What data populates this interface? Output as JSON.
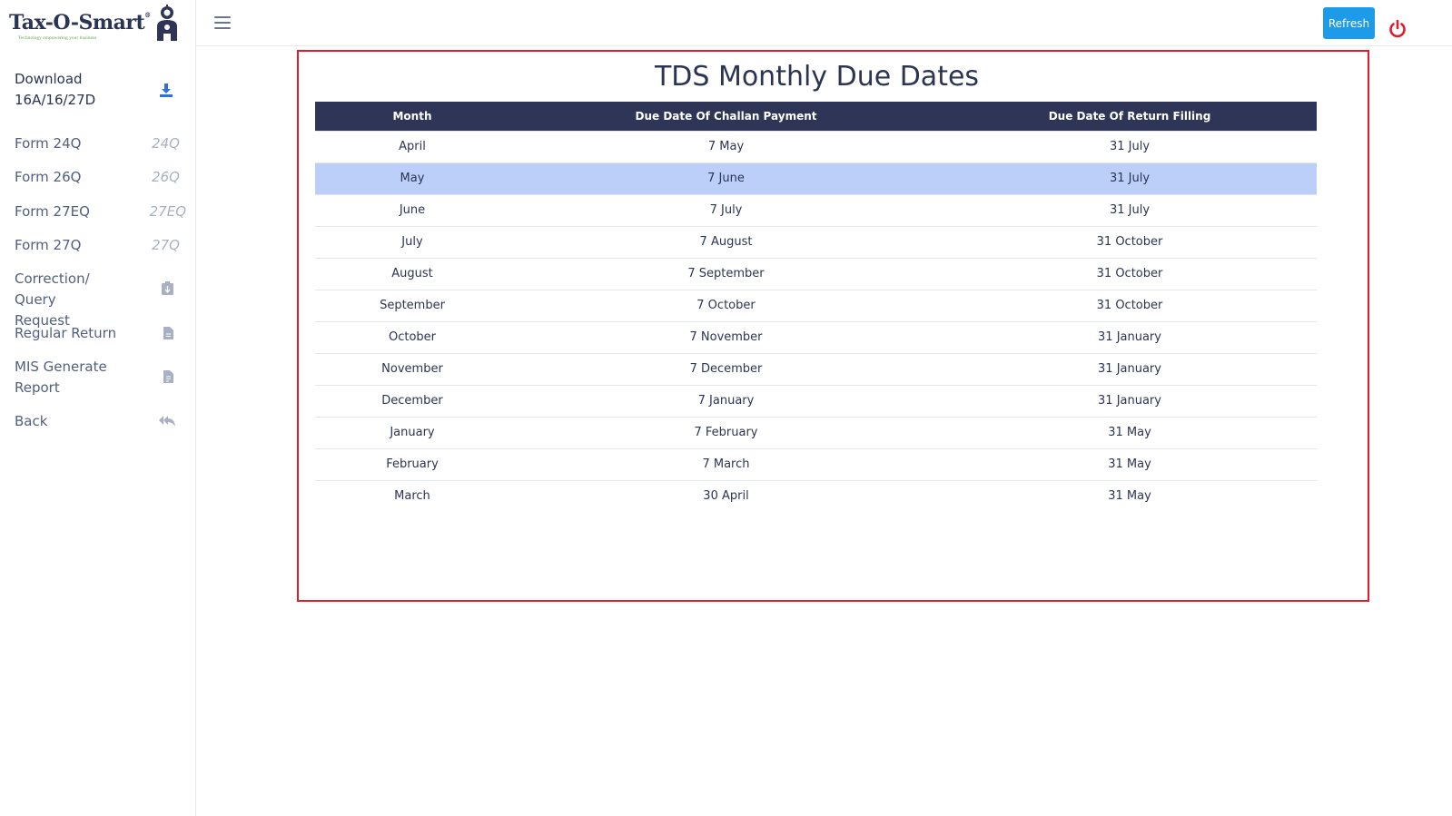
{
  "brand": {
    "name": "Tax-O-Smart",
    "reg_mark": "®",
    "tagline": "Technology empowering your business"
  },
  "sidebar": {
    "items": [
      {
        "label": "Download 16A/16/27D",
        "icon": "download-icon"
      },
      {
        "label": "Form 24Q",
        "abbr": "24Q"
      },
      {
        "label": "Form 26Q",
        "abbr": "26Q"
      },
      {
        "label": "Form 27EQ",
        "abbr": "27EQ"
      },
      {
        "label": "Form 27Q",
        "abbr": "27Q"
      },
      {
        "label": "Correction/ Query Request",
        "icon": "clipboard-icon"
      },
      {
        "label": "Regular Return",
        "icon": "file-icon"
      },
      {
        "label": "MIS Generate Report",
        "icon": "report-file-icon"
      },
      {
        "label": "Back",
        "icon": "reply-all-icon"
      }
    ]
  },
  "topbar": {
    "refresh_label": "Refresh"
  },
  "main": {
    "title": "TDS Monthly Due Dates",
    "columns": [
      "Month",
      "Due Date Of Challan Payment",
      "Due Date Of Return Filling"
    ],
    "rows": [
      [
        "April",
        "7 May",
        "31 July"
      ],
      [
        "May",
        "7 June",
        "31 July"
      ],
      [
        "June",
        "7 July",
        "31 July"
      ],
      [
        "July",
        "7 August",
        "31 October"
      ],
      [
        "August",
        "7 September",
        "31 October"
      ],
      [
        "September",
        "7 October",
        "31 October"
      ],
      [
        "October",
        "7 November",
        "31 January"
      ],
      [
        "November",
        "7 December",
        "31 January"
      ],
      [
        "December",
        "7 January",
        "31 January"
      ],
      [
        "January",
        "7 February",
        "31 May"
      ],
      [
        "February",
        "7 March",
        "31 May"
      ],
      [
        "March",
        "30 April",
        "31 May"
      ]
    ],
    "highlighted_row": 1
  },
  "colors": {
    "accent": "#1d9be8",
    "header_bg": "#2e3557",
    "highlight": "#bccff9",
    "panel_border": "#e21c2a",
    "power": "#e21c2a"
  }
}
